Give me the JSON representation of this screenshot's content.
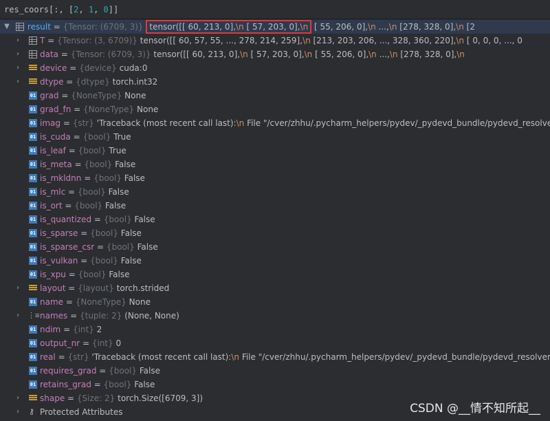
{
  "expression": {
    "id": "res_coors",
    "bracket_open": "[:, [",
    "n2": "2",
    "c1": ", ",
    "n1": "1",
    "c2": ", ",
    "n0": "0",
    "bracket_close": "]]"
  },
  "rows": [
    {
      "name": "result",
      "eq": " = ",
      "type": "{Tensor: (6709, 3)}",
      "value_hl": "tensor([[ 60, 213,    0],\\n           [ 57, 203,    0],\\n",
      "value_rest": "         [ 55, 206,    0],\\n         ...,\\n         [278, 328,    0],\\n         [2"
    },
    {
      "name": "T",
      "eq": " = ",
      "type": "{Tensor: (3, 6709)}",
      "value": " tensor([[ 60,  57,  55,  ..., 278, 214, 259],\\n         [213, 203, 206,  ..., 328, 360, 220],\\n         [  0,   0,   0,  ...,   0"
    },
    {
      "name": "data",
      "eq": " = ",
      "type": "{Tensor: (6709, 3)}",
      "value": " tensor([[ 60, 213,    0],\\n         [ 57, 203,    0],\\n         [ 55, 206,    0],\\n         ...,\\n         [278, 328,    0],\\n"
    },
    {
      "name": "device",
      "eq": " = ",
      "type": "{device}",
      "value": " cuda:0"
    },
    {
      "name": "dtype",
      "eq": " = ",
      "type": "{dtype}",
      "value": " torch.int32"
    },
    {
      "name": "grad",
      "eq": " = ",
      "type": "{NoneType}",
      "value": " None"
    },
    {
      "name": "grad_fn",
      "eq": " = ",
      "type": "{NoneType}",
      "value": " None"
    },
    {
      "name": "imag",
      "eq": " = ",
      "type": "{str}",
      "value": " 'Traceback (most recent call last):\\n  File \"/cver/zhhu/.pycharm_helpers/pydev/_pydevd_bundle/pydevd_resolver.py\""
    },
    {
      "name": "is_cuda",
      "eq": " = ",
      "type": "{bool}",
      "value": " True"
    },
    {
      "name": "is_leaf",
      "eq": " = ",
      "type": "{bool}",
      "value": " True"
    },
    {
      "name": "is_meta",
      "eq": " = ",
      "type": "{bool}",
      "value": " False"
    },
    {
      "name": "is_mkldnn",
      "eq": " = ",
      "type": "{bool}",
      "value": " False"
    },
    {
      "name": "is_mlc",
      "eq": " = ",
      "type": "{bool}",
      "value": " False"
    },
    {
      "name": "is_ort",
      "eq": " = ",
      "type": "{bool}",
      "value": " False"
    },
    {
      "name": "is_quantized",
      "eq": " = ",
      "type": "{bool}",
      "value": " False"
    },
    {
      "name": "is_sparse",
      "eq": " = ",
      "type": "{bool}",
      "value": " False"
    },
    {
      "name": "is_sparse_csr",
      "eq": " = ",
      "type": "{bool}",
      "value": " False"
    },
    {
      "name": "is_vulkan",
      "eq": " = ",
      "type": "{bool}",
      "value": " False"
    },
    {
      "name": "is_xpu",
      "eq": " = ",
      "type": "{bool}",
      "value": " False"
    },
    {
      "name": "layout",
      "eq": " = ",
      "type": "{layout}",
      "value": " torch.strided"
    },
    {
      "name": "name",
      "eq": " = ",
      "type": "{NoneType}",
      "value": " None"
    },
    {
      "name": "names",
      "eq": " = ",
      "type": "{tuple: 2}",
      "value": " (None, None)"
    },
    {
      "name": "ndim",
      "eq": " = ",
      "type": "{int}",
      "value": " 2"
    },
    {
      "name": "output_nr",
      "eq": " = ",
      "type": "{int}",
      "value": " 0"
    },
    {
      "name": "real",
      "eq": " = ",
      "type": "{str}",
      "value": " 'Traceback (most recent call last):\\n  File \"/cver/zhhu/.pycharm_helpers/pydev/_pydevd_bundle/pydevd_resolver.py\","
    },
    {
      "name": "requires_grad",
      "eq": " = ",
      "type": "{bool}",
      "value": " False"
    },
    {
      "name": "retains_grad",
      "eq": " = ",
      "type": "{bool}",
      "value": " False"
    },
    {
      "name": "shape",
      "eq": " = ",
      "type": "{Size: 2}",
      "value": " torch.Size([6709, 3])"
    },
    {
      "name": "Protected Attributes",
      "eq": "",
      "type": "",
      "value": ""
    }
  ],
  "watermark": "CSDN @__情不知所起__",
  "icons": {
    "expand": "chevron-down-icon",
    "collapse": "chevron-right-icon",
    "int": "01",
    "field": "field-bars-icon",
    "tensor": "table-icon",
    "tuple": "list-icon",
    "protected": "key-icon"
  },
  "colors": {
    "background": "#2b2d30",
    "name": "#c77dbb",
    "result_name": "#56a8f5",
    "type": "#6f737a",
    "value": "#bcbec4",
    "escape": "#cf8e6d",
    "highlight_box": "#e0393e"
  }
}
